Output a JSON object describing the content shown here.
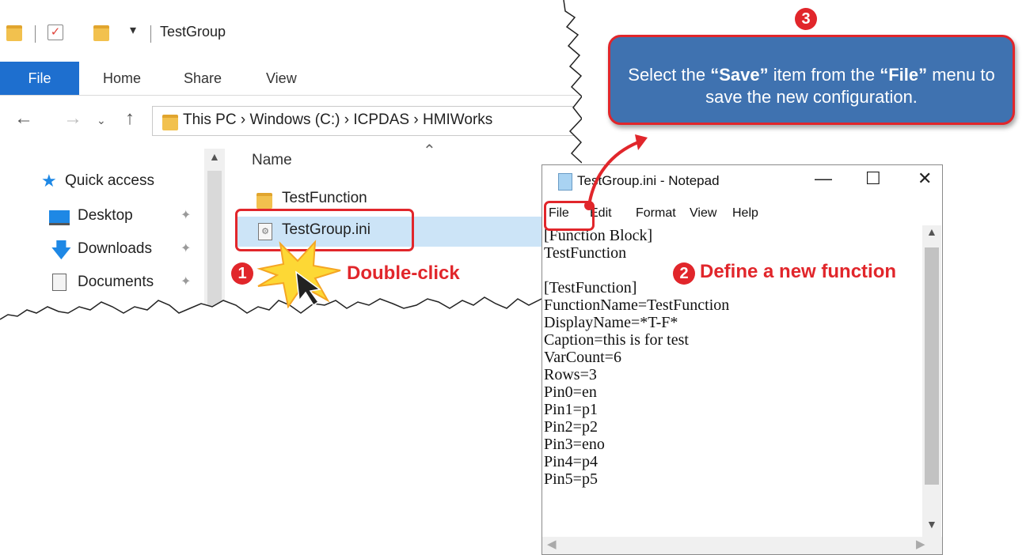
{
  "explorer": {
    "title": "TestGroup",
    "ribbon_tabs": [
      "File",
      "Home",
      "Share",
      "View"
    ],
    "address_path": "This PC  ›  Windows (C:)  ›  ICPDAS  ›  HMIWorks",
    "nav_items": [
      {
        "label": "Quick access",
        "icon": "star-icon",
        "pinned": false
      },
      {
        "label": "Desktop",
        "icon": "desktop-icon",
        "pinned": true
      },
      {
        "label": "Downloads",
        "icon": "download-icon",
        "pinned": true
      },
      {
        "label": "Documents",
        "icon": "documents-icon",
        "pinned": true
      }
    ],
    "column_header": "Name",
    "files": [
      {
        "name": "TestFunction",
        "icon": "folder-icon",
        "selected": false
      },
      {
        "name": "TestGroup.ini",
        "icon": "ini-file-icon",
        "selected": true
      }
    ]
  },
  "notepad": {
    "title": "TestGroup.ini - Notepad",
    "menu": [
      "File",
      "Edit",
      "Format",
      "View",
      "Help"
    ],
    "content_lines": [
      "[Function Block]",
      "TestFunction",
      "",
      "[TestFunction]",
      "FunctionName=TestFunction",
      "DisplayName=*T-F*",
      "Caption=this is for test",
      "VarCount=6",
      "Rows=3",
      "Pin0=en",
      "Pin1=p1",
      "Pin2=p2",
      "Pin3=eno",
      "Pin4=p4",
      "Pin5=p5"
    ]
  },
  "annotations": {
    "step1": {
      "number": "1",
      "label": "Double-click"
    },
    "step2": {
      "number": "2",
      "label": "Define a new function"
    },
    "step3": {
      "number": "3",
      "text_pre": "Select the ",
      "save": "“Save”",
      "text_mid": " item from the ",
      "file": "“File”",
      "text_post": " menu to save the new configuration."
    },
    "accent_color": "#e1262b",
    "callout_color": "#3f72b0"
  }
}
